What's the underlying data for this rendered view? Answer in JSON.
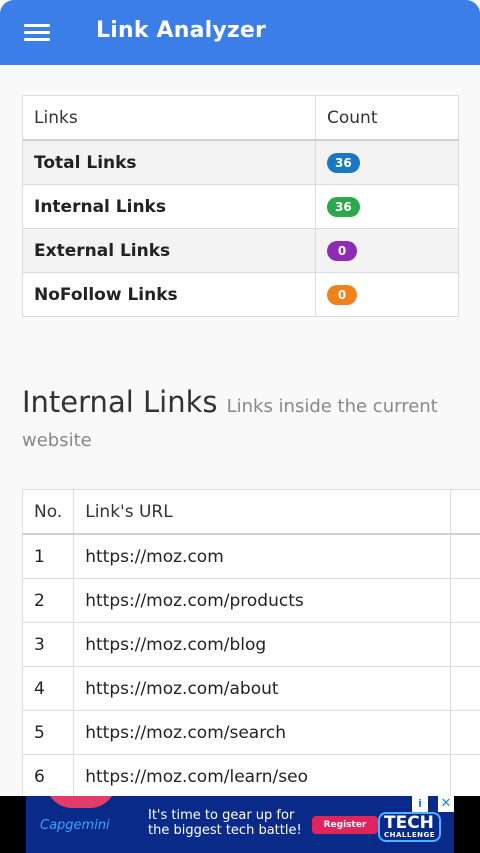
{
  "app": {
    "title": "Link Analyzer",
    "menu_icon": "hamburger-menu-icon"
  },
  "summary": {
    "headers": [
      "Links",
      "Count"
    ],
    "rows": [
      {
        "label": "Total Links",
        "count": "36",
        "color": "#1a78c2"
      },
      {
        "label": "Internal Links",
        "count": "36",
        "color": "#2aa84a"
      },
      {
        "label": "External Links",
        "count": "0",
        "color": "#8e2bb5"
      },
      {
        "label": "NoFollow Links",
        "count": "0",
        "color": "#f0821e"
      }
    ]
  },
  "internal": {
    "title": "Internal Links",
    "subtitle": "Links inside the current website",
    "headers": [
      "No.",
      "Link's URL",
      ""
    ],
    "rows": [
      {
        "no": "1",
        "url": "https://moz.com"
      },
      {
        "no": "2",
        "url": "https://moz.com/products"
      },
      {
        "no": "3",
        "url": "https://moz.com/blog"
      },
      {
        "no": "4",
        "url": "https://moz.com/about"
      },
      {
        "no": "5",
        "url": "https://moz.com/search"
      },
      {
        "no": "6",
        "url": "https://moz.com/learn/seo"
      }
    ]
  },
  "ad": {
    "brand": "Capgemini",
    "text": "It's time to gear up for the biggest tech battle!",
    "button": "Register",
    "logo_main": "TECH",
    "logo_sub": "CHALLENGE",
    "info_icon": "ad-info-icon",
    "close_icon": "ad-close-icon"
  },
  "colors": {
    "appbar": "#3b7ee8"
  }
}
